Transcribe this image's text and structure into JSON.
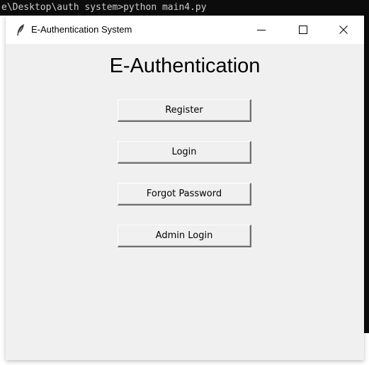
{
  "terminal": {
    "text": "e\\Desktop\\auth system>python main4.py"
  },
  "window": {
    "title": "E-Authentication System",
    "icon": "feather-icon"
  },
  "controls": {
    "minimize_icon": "minimize-icon",
    "maximize_icon": "maximize-icon",
    "close_icon": "close-icon"
  },
  "main": {
    "heading": "E-Authentication",
    "buttons": [
      {
        "label": "Register"
      },
      {
        "label": "Login"
      },
      {
        "label": "Forgot Password"
      },
      {
        "label": "Admin Login"
      }
    ]
  },
  "colors": {
    "window_background": "#f0f0f0",
    "titlebar_background": "#ffffff",
    "terminal_background": "#0c0c0c"
  }
}
